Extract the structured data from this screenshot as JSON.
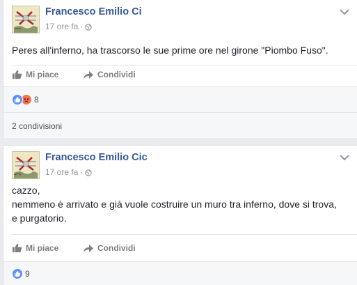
{
  "posts": [
    {
      "author": "Francesco Emilio Ci",
      "time": "17 ore fa",
      "separator": "·",
      "privacy_icon": "globe-icon",
      "text_lines": [
        "Peres all'inferno, ha trascorso le sue prime ore nel girone \"Piombo Fuso\"."
      ],
      "like_label": "Mi piace",
      "share_label": "Condividi",
      "reactions": [
        "like-icon",
        "angry-icon"
      ],
      "reaction_count": "8",
      "shares_text": "2 condivisioni"
    },
    {
      "author": "Francesco Emilio Cic",
      "time": "17 ore fa",
      "separator": "·",
      "privacy_icon": "globe-icon",
      "text_lines": [
        "cazzo,",
        "nemmeno è arrivato e già vuole costruire un muro tra inferno, dove si trova,",
        "e purgatorio."
      ],
      "like_label": "Mi piace",
      "share_label": "Condividi",
      "reactions": [
        "like-icon"
      ],
      "reaction_count": "9"
    }
  ],
  "colors": {
    "background": "#e9ebee",
    "author_link": "#365899",
    "meta_text": "#90949c",
    "action_text": "#7f7f7f",
    "like_blue": "#5890ff",
    "angry_orange": "#f25268"
  }
}
